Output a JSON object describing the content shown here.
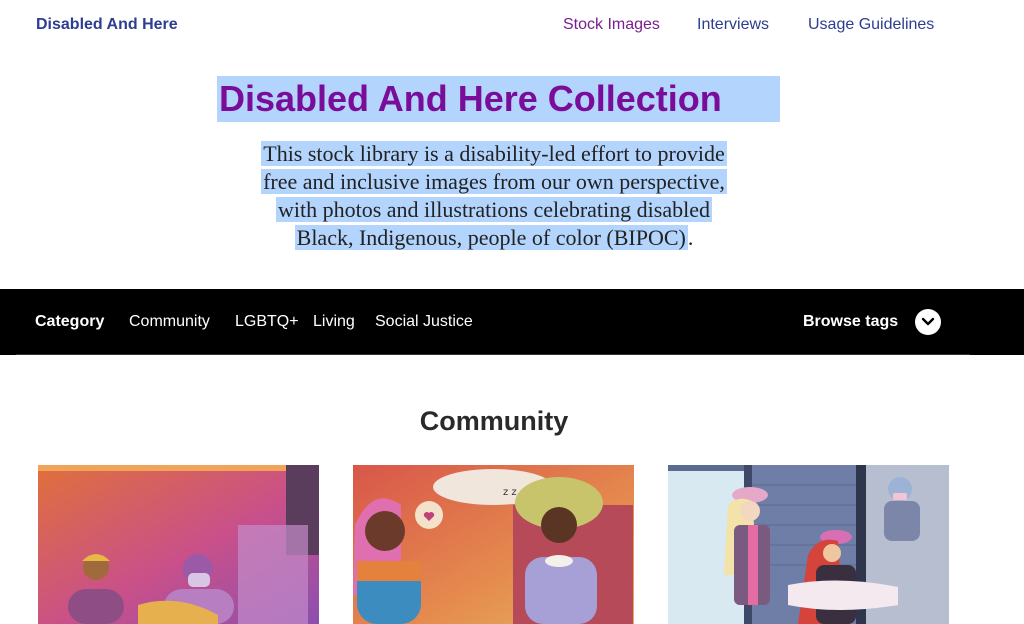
{
  "header": {
    "brand": "Disabled And Here",
    "nav": {
      "stock_images": "Stock Images",
      "interviews": "Interviews",
      "usage_guidelines": "Usage Guidelines"
    }
  },
  "hero": {
    "title": "Disabled And Here Collection",
    "description_lines": [
      "This stock library is a disability-led effort to provide",
      "free and inclusive images from our own perspective,",
      "with photos and illustrations celebrating disabled",
      "Black, Indigenous, people of color (BIPOC)"
    ],
    "description_end": "."
  },
  "category_bar": {
    "label": "Category",
    "items": [
      "Community",
      "LGBTQ+",
      "Living",
      "Social Justice"
    ],
    "browse_tags": "Browse tags"
  },
  "section": {
    "title": "Community"
  },
  "colors": {
    "brand_blue": "#2c3e8f",
    "accent_purple": "#7a0c9a",
    "selection_highlight": "#b3d4fc",
    "category_bar_bg": "#000000"
  }
}
